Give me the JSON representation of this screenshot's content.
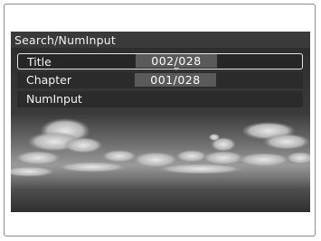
{
  "screen": {
    "title": "Search/NumInput"
  },
  "menu": {
    "items": [
      {
        "label": "Title",
        "value": "002/028",
        "selected": true
      },
      {
        "label": "Chapter",
        "value": "001/028",
        "selected": false
      },
      {
        "label": "NumInput",
        "value": "",
        "selected": false
      }
    ]
  },
  "colors": {
    "screen_bg": "#3a3a3a",
    "value_bg": "#5a5a5a",
    "text": "#f5f5f5"
  }
}
